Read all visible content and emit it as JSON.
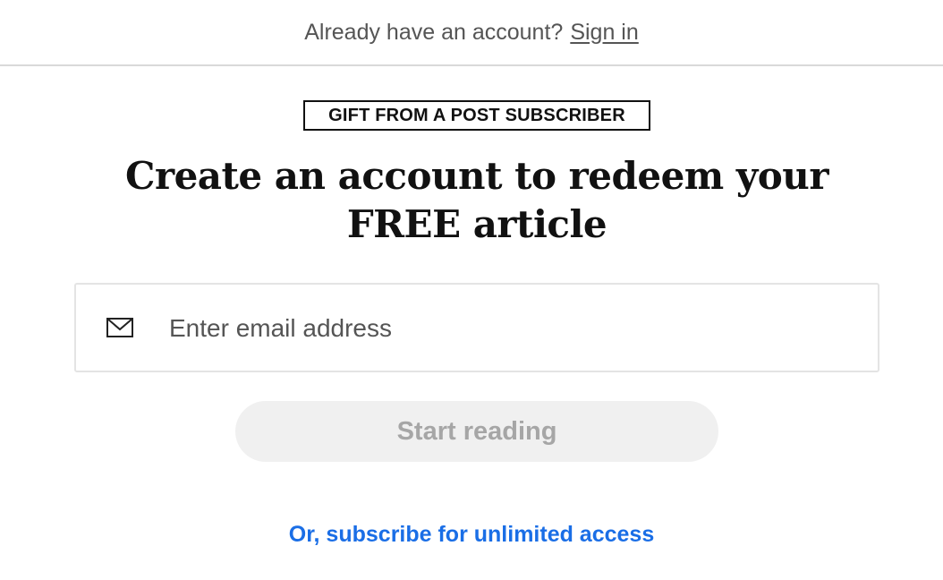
{
  "top_bar": {
    "prompt": "Already have an account?",
    "signin_label": "Sign in"
  },
  "gift_badge": {
    "label": "GIFT FROM A POST SUBSCRIBER"
  },
  "headline": {
    "text": "Create an account to redeem your FREE article"
  },
  "email": {
    "icon": "mail-icon",
    "placeholder": "Enter email address",
    "value": ""
  },
  "start_button": {
    "label": "Start reading",
    "enabled": false
  },
  "subscribe_link": {
    "label": "Or, subscribe for unlimited access"
  },
  "colors": {
    "link_blue": "#1a6ee6",
    "button_disabled_bg": "#f0f0f0",
    "button_disabled_text": "#a6a6a6"
  }
}
